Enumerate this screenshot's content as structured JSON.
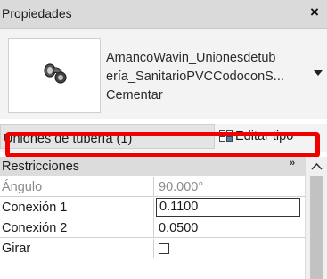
{
  "titlebar": {
    "title": "Propiedades",
    "close_glyph": "×"
  },
  "type_selector": {
    "thumbnail_icon": "pipe-elbow-fitting-icon",
    "name_lines": [
      "AmancoWavin_Unionesdetub",
      "ería_SanitarioPVCCodoconS...",
      "Cementar"
    ],
    "dropdown_icon": "chevron-down-icon"
  },
  "instance_selector": {
    "label": "Uniones de tubería (1)"
  },
  "edit_type": {
    "label": "Editar tipo",
    "icon": "edit-type-icon"
  },
  "properties": {
    "category": {
      "label": "Restricciones",
      "toggle_glyph": "»"
    },
    "rows": [
      {
        "name": "Ángulo",
        "value": "90.000°",
        "disabled": true
      },
      {
        "name": "Conexión 1",
        "value": "0.1100",
        "editing": true
      },
      {
        "name": "Conexión 2",
        "value": "0.0500"
      },
      {
        "name": "Girar",
        "value": "",
        "checkbox": true,
        "checked": false
      }
    ]
  },
  "colors": {
    "highlight": "#f10000",
    "titlebar": "#dadada",
    "panel": "#f3f3f3"
  }
}
